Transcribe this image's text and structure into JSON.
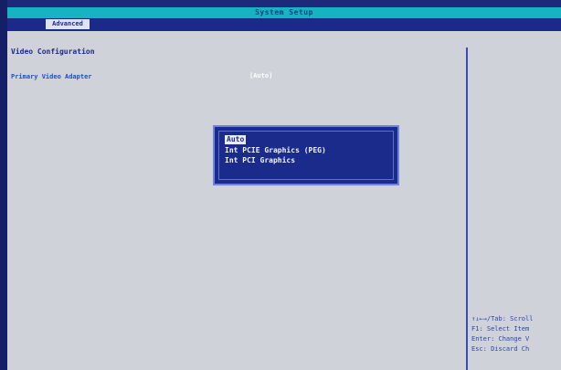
{
  "window": {
    "title": "System Setup"
  },
  "tabs": [
    {
      "label": "Advanced",
      "active": true
    }
  ],
  "page": {
    "section_title": "Video Configuration",
    "setting_label": "Primary Video Adapter",
    "setting_value": "[Auto]"
  },
  "popup": {
    "options": [
      {
        "label": "Auto",
        "selected": true
      },
      {
        "label": "Int PCIE Graphics (PEG)",
        "selected": false
      },
      {
        "label": "Int PCI Graphics",
        "selected": false
      }
    ]
  },
  "help": {
    "lines": [
      "↑↓←→/Tab: Scroll",
      "F1: Select Item",
      "Enter: Change V",
      "Esc: Discard Ch"
    ]
  },
  "colors": {
    "background_blue": "#1d2a7a",
    "titlebar_cyan": "#16b3c2",
    "panel_gray": "#cfd2d8",
    "accent_text": "#1f4fc0"
  }
}
